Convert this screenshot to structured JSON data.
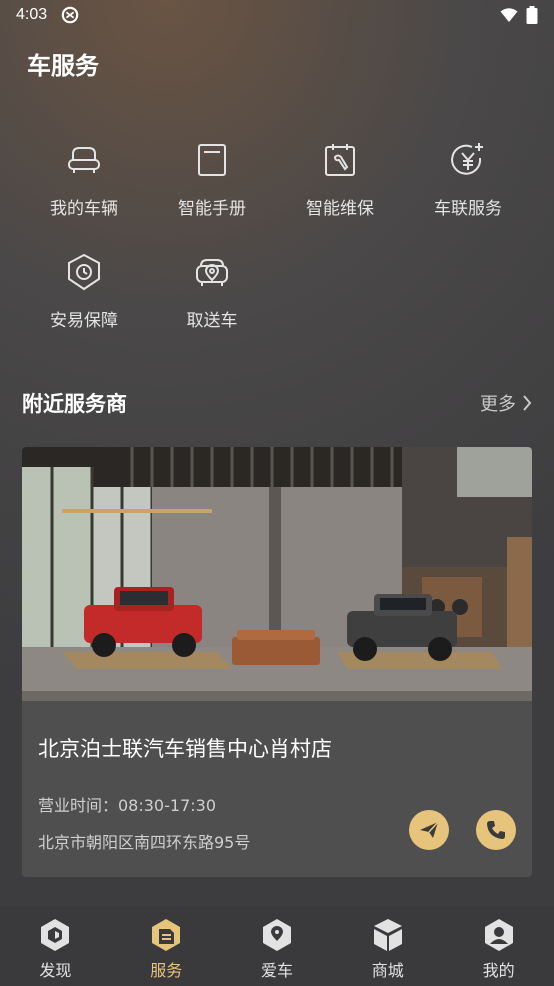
{
  "status": {
    "time": "4:03"
  },
  "page": {
    "title": "车服务"
  },
  "services": [
    {
      "label": "我的车辆",
      "icon": "car-seat-icon"
    },
    {
      "label": "智能手册",
      "icon": "manual-icon"
    },
    {
      "label": "智能维保",
      "icon": "maintenance-icon"
    },
    {
      "label": "车联服务",
      "icon": "yuan-plus-icon"
    },
    {
      "label": "安易保障",
      "icon": "shield-clock-icon"
    },
    {
      "label": "取送车",
      "icon": "car-location-icon"
    }
  ],
  "nearby": {
    "title": "附近服务商",
    "more": "更多",
    "store": {
      "name": "北京泊士联汽车销售中心肖村店",
      "hours_label": "营业时间：08:30-17:30",
      "address": "北京市朝阳区南四环东路95号"
    }
  },
  "tabbar": [
    {
      "label": "发现",
      "icon": "discover-icon",
      "active": false
    },
    {
      "label": "服务",
      "icon": "service-icon",
      "active": true
    },
    {
      "label": "爱车",
      "icon": "my-car-icon",
      "active": false
    },
    {
      "label": "商城",
      "icon": "mall-icon",
      "active": false
    },
    {
      "label": "我的",
      "icon": "profile-icon",
      "active": false
    }
  ],
  "colors": {
    "accent": "#e7c47b",
    "tabbar_bg": "#3a3a3c",
    "card_bg": "#4f4f50"
  }
}
